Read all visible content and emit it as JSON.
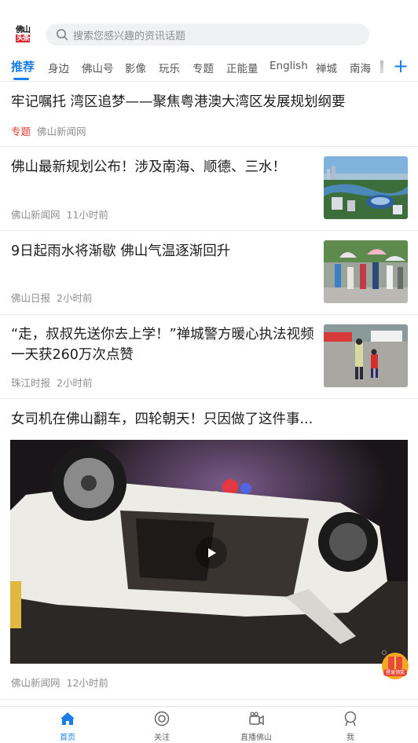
{
  "header": {
    "logo_top": "佛山",
    "logo_bottom": "头条",
    "search_placeholder": "搜索您感兴趣的资讯话题"
  },
  "tabs": [
    {
      "label": "推荐",
      "active": true
    },
    {
      "label": "身边"
    },
    {
      "label": "佛山号"
    },
    {
      "label": "影像"
    },
    {
      "label": "玩乐"
    },
    {
      "label": "专题"
    },
    {
      "label": "正能量"
    },
    {
      "label": "English"
    },
    {
      "label": "禅城"
    },
    {
      "label": "南海"
    }
  ],
  "tabs_add_label": "+",
  "feed": [
    {
      "title": "牢记嘱托 湾区追梦——聚焦粤港澳大湾区发展规划纲要",
      "tag": "专题",
      "source": "佛山新闻网"
    },
    {
      "title": "佛山最新规划公布！涉及南海、顺德、三水！",
      "source": "佛山新闻网",
      "time": "11小时前",
      "thumb": "city-aerial-image"
    },
    {
      "title": "9日起雨水将渐歇 佛山气温逐渐回升",
      "source": "佛山日报",
      "time": "2小时前",
      "thumb": "crowd-umbrellas-image"
    },
    {
      "title": "“走，叔叔先送你去上学！”禅城警方暖心执法视频一天获260万次点赞",
      "source": "珠江时报",
      "time": "2小时前",
      "thumb": "police-child-crossing-image"
    },
    {
      "title": "女司机在佛山翻车，四轮朝天！只因做了这件事...",
      "source": "佛山新闻网",
      "time": "12小时前",
      "video": "overturned-car-video"
    }
  ],
  "promo_label": "登录领奖",
  "bottom_nav": [
    {
      "label": "首页",
      "icon": "home-icon",
      "active": true
    },
    {
      "label": "关注",
      "icon": "follow-icon"
    },
    {
      "label": "直播佛山",
      "icon": "live-camera-icon"
    },
    {
      "label": "我",
      "icon": "user-icon"
    }
  ],
  "colors": {
    "accent": "#1a7ee6",
    "tag_red": "#e13a2f",
    "logo_red": "#d6262b"
  }
}
